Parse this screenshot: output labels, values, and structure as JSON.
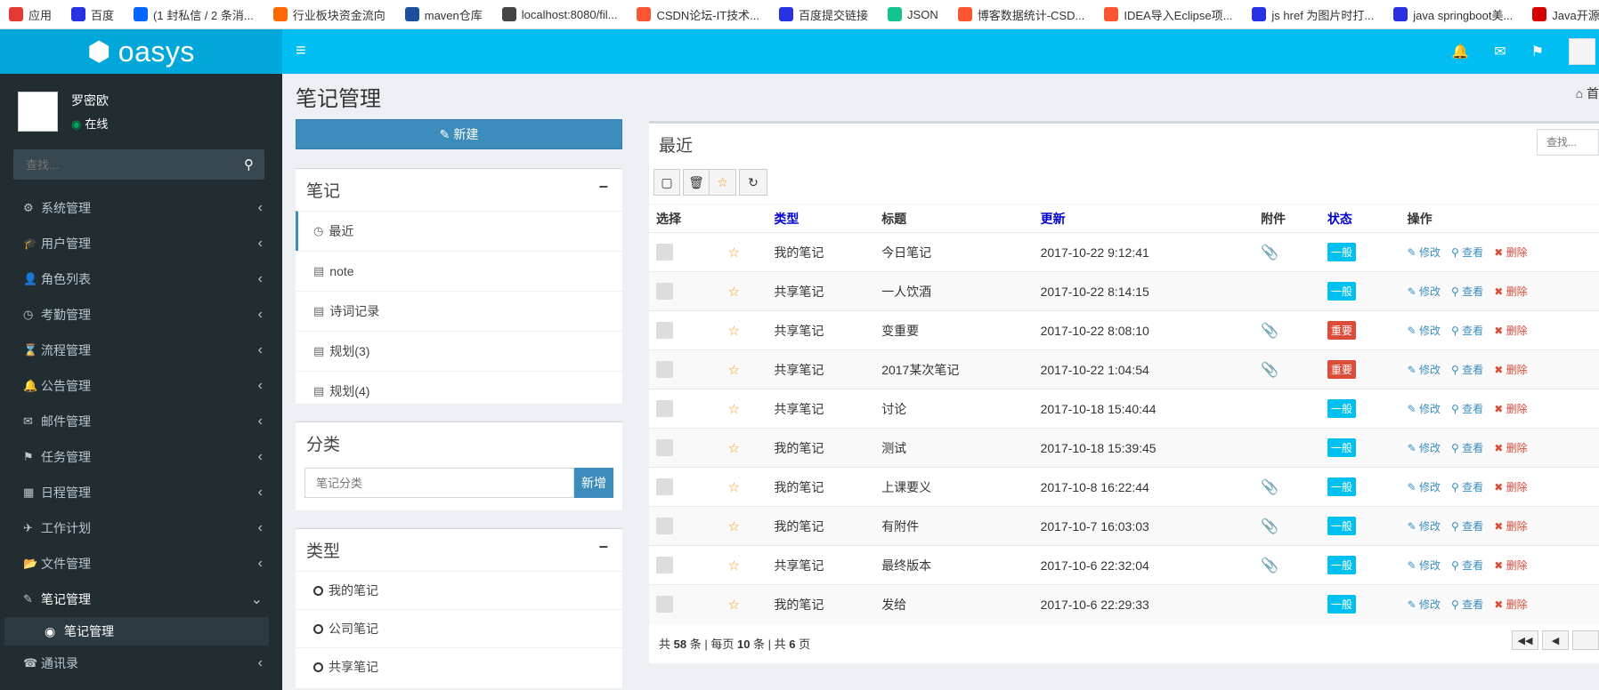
{
  "bookmarks": [
    {
      "label": "应用",
      "icon": "apps-grid-icon",
      "color": "#e53935"
    },
    {
      "label": "百度",
      "icon": "baidu-paw-icon",
      "color": "#2932e1"
    },
    {
      "label": "(1 封私信 / 2 条消...",
      "icon": "zhihu-icon",
      "color": "#0066ff"
    },
    {
      "label": "行业板块资金流向",
      "icon": "eastmoney-icon",
      "color": "#ff6a00"
    },
    {
      "label": "maven仓库",
      "icon": "mvn-icon",
      "color": "#1e4f9c"
    },
    {
      "label": "localhost:8080/fil...",
      "icon": "globe-icon",
      "color": "#444444"
    },
    {
      "label": "CSDN论坛-IT技术...",
      "icon": "csdn-icon",
      "color": "#fc5531"
    },
    {
      "label": "百度提交链接",
      "icon": "baidu-paw-icon",
      "color": "#2932e1"
    },
    {
      "label": "JSON",
      "icon": "json-icon",
      "color": "#14c38e"
    },
    {
      "label": "博客数据统计-CSD...",
      "icon": "csdn-icon",
      "color": "#fc5531"
    },
    {
      "label": "IDEA导入Eclipse项...",
      "icon": "csdn-icon",
      "color": "#fc5531"
    },
    {
      "label": "js href 为图片时打...",
      "icon": "baidu-paw-icon",
      "color": "#2932e1"
    },
    {
      "label": "java springboot美...",
      "icon": "baidu-paw-icon",
      "color": "#2932e1"
    },
    {
      "label": "Java开源项目",
      "icon": "j-icon",
      "color": "#d50000"
    }
  ],
  "header": {
    "logo_text": "oasys",
    "toggle_glyph": "≡"
  },
  "user": {
    "name": "罗密欧",
    "status": "在线"
  },
  "sidebar": {
    "search_placeholder": "查找...",
    "menu": [
      {
        "label": "系统管理",
        "icon": "gear-icon",
        "glyph": "⚙"
      },
      {
        "label": "用户管理",
        "icon": "graduation-cap-icon",
        "glyph": "🎓"
      },
      {
        "label": "角色列表",
        "icon": "user-icon",
        "glyph": "👤"
      },
      {
        "label": "考勤管理",
        "icon": "clock-icon",
        "glyph": "◷"
      },
      {
        "label": "流程管理",
        "icon": "hourglass-icon",
        "glyph": "⌛"
      },
      {
        "label": "公告管理",
        "icon": "bell-icon",
        "glyph": "🔔"
      },
      {
        "label": "邮件管理",
        "icon": "envelope-icon",
        "glyph": "✉"
      },
      {
        "label": "任务管理",
        "icon": "flag-icon",
        "glyph": "⚑"
      },
      {
        "label": "日程管理",
        "icon": "calendar-icon",
        "glyph": "▦"
      },
      {
        "label": "工作计划",
        "icon": "plane-icon",
        "glyph": "✈"
      },
      {
        "label": "文件管理",
        "icon": "folder-open-icon",
        "glyph": "📂"
      },
      {
        "label": "笔记管理",
        "icon": "edit-icon",
        "glyph": "✎"
      }
    ],
    "submenu_label": "笔记管理",
    "last_item": {
      "label": "通讯录",
      "icon": "phone-icon",
      "glyph": "☎"
    }
  },
  "page": {
    "title": "笔记管理",
    "breadcrumb_home": "首",
    "new_button": "新建"
  },
  "notes_panel": {
    "title": "笔记",
    "items": [
      "最近",
      "note",
      "诗词记录",
      "规划(3)",
      "规划(4)"
    ]
  },
  "category_panel": {
    "title": "分类",
    "placeholder": "笔记分类",
    "add_button": "新增"
  },
  "type_panel": {
    "title": "类型",
    "items": [
      "我的笔记",
      "公司笔记",
      "共享笔记"
    ]
  },
  "main": {
    "title": "最近",
    "search_placeholder": "查找...",
    "columns": [
      "选择",
      "",
      "类型",
      "标题",
      "更新",
      "附件",
      "状态",
      "操作"
    ],
    "actions": {
      "edit": "修改",
      "view": "查看",
      "delete": "删除"
    },
    "rows": [
      {
        "type": "我的笔记",
        "title": "今日笔记",
        "updated": "2017-10-22 9:12:41",
        "attachment": true,
        "status": "一般",
        "status_kind": "normal"
      },
      {
        "type": "共享笔记",
        "title": "一人饮酒",
        "updated": "2017-10-22 8:14:15",
        "attachment": false,
        "status": "一般",
        "status_kind": "normal"
      },
      {
        "type": "共享笔记",
        "title": "变重要",
        "updated": "2017-10-22 8:08:10",
        "attachment": true,
        "status": "重要",
        "status_kind": "important"
      },
      {
        "type": "共享笔记",
        "title": "2017某次笔记",
        "updated": "2017-10-22 1:04:54",
        "attachment": true,
        "status": "重要",
        "status_kind": "important"
      },
      {
        "type": "共享笔记",
        "title": "讨论",
        "updated": "2017-10-18 15:40:44",
        "attachment": false,
        "status": "一般",
        "status_kind": "normal"
      },
      {
        "type": "我的笔记",
        "title": "测试",
        "updated": "2017-10-18 15:39:45",
        "attachment": false,
        "status": "一般",
        "status_kind": "normal"
      },
      {
        "type": "我的笔记",
        "title": "上课要义",
        "updated": "2017-10-8 16:22:44",
        "attachment": true,
        "status": "一般",
        "status_kind": "normal"
      },
      {
        "type": "我的笔记",
        "title": "有附件",
        "updated": "2017-10-7 16:03:03",
        "attachment": true,
        "status": "一般",
        "status_kind": "normal"
      },
      {
        "type": "共享笔记",
        "title": "最终版本",
        "updated": "2017-10-6 22:32:04",
        "attachment": true,
        "status": "一般",
        "status_kind": "normal"
      },
      {
        "type": "我的笔记",
        "title": "发给",
        "updated": "2017-10-6 22:29:33",
        "attachment": false,
        "status": "一般",
        "status_kind": "normal"
      }
    ],
    "footer": {
      "total_prefix": "共",
      "total": "58",
      "per_page_prefix": "条 | 每页",
      "per_page": "10",
      "pages_prefix": "条 | 共",
      "pages": "6",
      "pages_suffix": "页"
    }
  },
  "colors": {
    "header": "#00bdf2",
    "logo_bg": "#00a7d8",
    "sidebar": "#222d32",
    "primary": "#3c8dbc",
    "normal_badge": "#00c0ef",
    "important_badge": "#dd4b39"
  }
}
